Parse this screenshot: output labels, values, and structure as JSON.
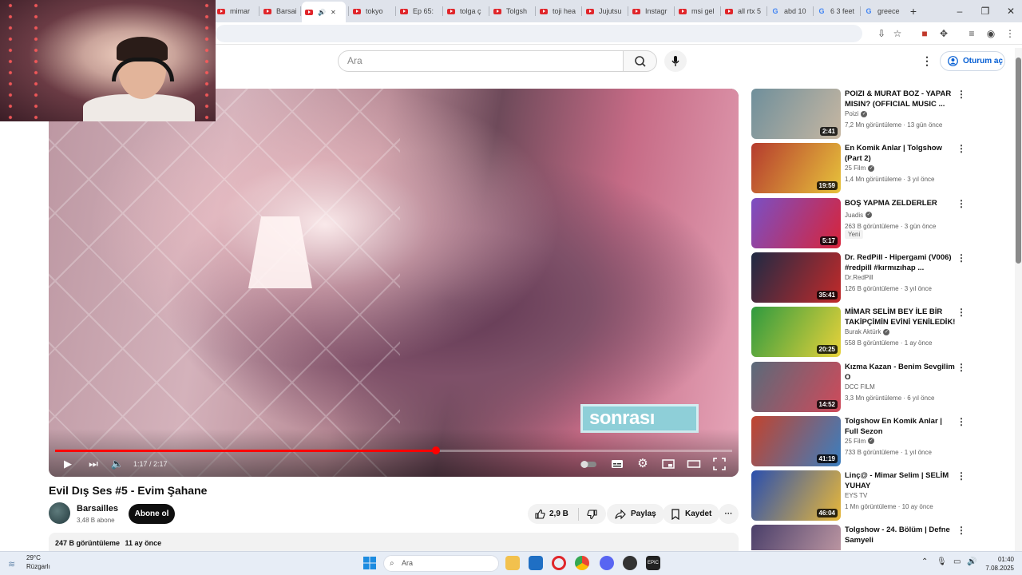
{
  "browser": {
    "tabs": [
      {
        "label": "mimar",
        "kind": "yt"
      },
      {
        "label": "Barsaill",
        "kind": "yt"
      },
      {
        "label": "",
        "kind": "yt",
        "active": true
      },
      {
        "label": "tokyo",
        "kind": "yt"
      },
      {
        "label": "Ep 65:",
        "kind": "yt"
      },
      {
        "label": "tolga ç",
        "kind": "yt"
      },
      {
        "label": "Tolgsh",
        "kind": "yt"
      },
      {
        "label": "toji hea",
        "kind": "yt"
      },
      {
        "label": "Jujutsu",
        "kind": "yt"
      },
      {
        "label": "Instagr",
        "kind": "yt"
      },
      {
        "label": "msi gel",
        "kind": "yt"
      },
      {
        "label": "all rtx 5",
        "kind": "yt"
      },
      {
        "label": "abd 10",
        "kind": "google"
      },
      {
        "label": "6 3 feet",
        "kind": "google"
      },
      {
        "label": "greece",
        "kind": "google"
      }
    ],
    "new_tab": "+",
    "window_controls": {
      "minimize": "–",
      "maximize": "❐",
      "close": "✕"
    }
  },
  "header": {
    "search_placeholder": "Ara",
    "signin_label": "Oturum aç",
    "more_icon": "⋮"
  },
  "player": {
    "current_time": "1:17",
    "duration": "2:17",
    "time_text": "1:17 / 2:17",
    "progress_fraction": 0.562,
    "overlay_text": "sonrası"
  },
  "video": {
    "title": "Evil Dış Ses #5 - Evim Şahane",
    "channel": "Barsailles",
    "subscribers": "3,48 B abone",
    "subscribe_label": "Abone ol",
    "likes": "2,9 B",
    "share_label": "Paylaş",
    "save_label": "Kaydet",
    "more_label": "···",
    "views": "247 B görüntüleme",
    "uploaded": "11 ay önce"
  },
  "suggestions": [
    {
      "title": "POIZI & MURAT BOZ - YAPAR MISIN? (OFFICIAL MUSIC ...",
      "channel": "Poizi",
      "verified": true,
      "meta": "7,2 Mn görüntüleme · 13 gün önce",
      "duration": "2:41",
      "badge": "",
      "thumb": [
        "#6f8f9b",
        "#c7b7a2"
      ]
    },
    {
      "title": "En Komik Anlar | Tolgshow (Part 2)",
      "channel": "25 Film",
      "verified": true,
      "meta": "1,4 Mn görüntüleme · 3 yıl önce",
      "duration": "19:59",
      "badge": "",
      "thumb": [
        "#b53b2e",
        "#e7c33b"
      ]
    },
    {
      "title": "BOŞ YAPMA ZELDERLER",
      "channel": "Juadis",
      "verified": true,
      "meta": "263 B görüntüleme · 3 gün önce",
      "duration": "5:17",
      "badge": "Yeni",
      "thumb": [
        "#7a4fc4",
        "#d8243a"
      ]
    },
    {
      "title": "Dr. RedPill - Hipergami (V006) #redpill #kırmızıhap ...",
      "channel": "Dr.RedPill",
      "verified": false,
      "meta": "126 B görüntüleme · 3 yıl önce",
      "duration": "35:41",
      "badge": "",
      "thumb": [
        "#1f2a44",
        "#c22a2a"
      ]
    },
    {
      "title": "MİMAR SELİM BEY İLE BİR TAKİPÇİMİN EVİNİ YENİLEDİK!",
      "channel": "Burak Aktürk",
      "verified": true,
      "meta": "558 B görüntüleme · 1 ay önce",
      "duration": "20:25",
      "badge": "",
      "thumb": [
        "#2f9a3f",
        "#e8d23a"
      ]
    },
    {
      "title": "Kızma Kazan - Benim Sevgilim O",
      "channel": "DCC FILM",
      "verified": false,
      "meta": "3,3 Mn görüntüleme · 6 yıl önce",
      "duration": "14:52",
      "badge": "",
      "thumb": [
        "#5a6a7a",
        "#d04a5a"
      ]
    },
    {
      "title": "Tolgshow En Komik Anlar | Full Sezon",
      "channel": "25 Film",
      "verified": true,
      "meta": "733 B görüntüleme · 1 yıl önce",
      "duration": "41:19",
      "badge": "",
      "thumb": [
        "#c2432e",
        "#3a7fc0"
      ]
    },
    {
      "title": "Linç@ - Mimar Selim | SELİM YUHAY",
      "channel": "EYS TV",
      "verified": false,
      "meta": "1 Mn görüntüleme · 10 ay önce",
      "duration": "46:04",
      "badge": "",
      "thumb": [
        "#2a4fae",
        "#e8b83a"
      ]
    },
    {
      "title": "Tolgshow - 24. Bölüm | Defne Samyeli",
      "channel": "",
      "verified": false,
      "meta": "",
      "duration": "",
      "badge": "",
      "thumb": [
        "#4a3f6a",
        "#c9a0a8"
      ]
    }
  ],
  "taskbar": {
    "weather_temp": "29°C",
    "weather_desc": "Rüzgarlı",
    "search_label": "Ara",
    "time": "01:40",
    "date": "7.08.2025"
  },
  "colors": {
    "accent": "#ff0000",
    "link": "#065fd4"
  }
}
